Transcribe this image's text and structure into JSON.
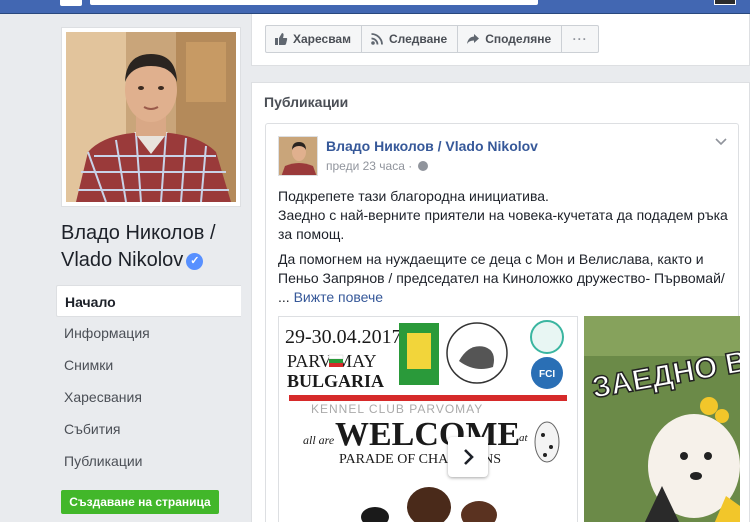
{
  "topbar": {
    "brand_color": "#4267b2"
  },
  "page": {
    "name": "Владо Николов / Vlado Nikolov",
    "verified": true
  },
  "nav": {
    "items": [
      {
        "label": "Начало",
        "active": true
      },
      {
        "label": "Информация"
      },
      {
        "label": "Снимки"
      },
      {
        "label": "Харесвания"
      },
      {
        "label": "Събития"
      },
      {
        "label": "Публикации"
      }
    ]
  },
  "create_page_label": "Създаване на страница",
  "actions": {
    "like": "Харесвам",
    "follow": "Следване",
    "share": "Споделяне",
    "more": "···"
  },
  "publications": {
    "title": "Публикации",
    "post": {
      "author": "Владо Николов / Vlado Nikolov",
      "time": "преди 23 часа",
      "line1": "Подкрепете тази благородна инициатива.",
      "line2": "Заедно с най-верните приятели на човека-кучетата да подадем ръка за помощ.",
      "line3": "Да помогнем на нуждаещите се деца с Мон и Велислава, както и Пеньо Запрянов / председател на Киноложко дружество- Първомай/",
      "ellipsis": "...",
      "see_more": "Вижте повече"
    },
    "poster": {
      "date": "29-30.04.2017",
      "city": "PARV MAY",
      "country": "BULGARIA",
      "club": "KENNEL CLUB PARVOMAY",
      "all_are": "all are",
      "welcome": "WELCOME",
      "at": "at",
      "parade": "PARADE OF CHAMPIONS",
      "fci": "FCI"
    },
    "second_image": {
      "text": "ЗАЕДНО В"
    }
  }
}
